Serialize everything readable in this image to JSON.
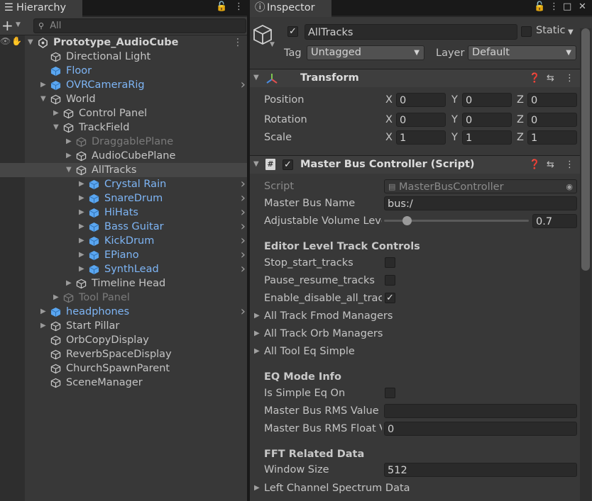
{
  "hierarchy": {
    "tab_label": "Hierarchy",
    "search_placeholder": "All",
    "add_label": "+",
    "rows": [
      {
        "label": "Prototype_AudioCube",
        "style": "bold",
        "indent": 0,
        "arrow": "down",
        "icon": "unity-icon"
      },
      {
        "label": "Directional Light",
        "style": "normal",
        "indent": 1,
        "arrow": "",
        "icon": "cube-outline-icon"
      },
      {
        "label": "Floor",
        "style": "blue",
        "indent": 1,
        "arrow": "",
        "icon": "prefab-cube-icon"
      },
      {
        "label": "OVRCameraRig",
        "style": "blue",
        "indent": 1,
        "arrow": "right",
        "icon": "prefab-cube-icon",
        "chevron": true
      },
      {
        "label": "World",
        "style": "normal",
        "indent": 1,
        "arrow": "down",
        "icon": "cube-outline-icon"
      },
      {
        "label": "Control Panel",
        "style": "normal",
        "indent": 2,
        "arrow": "right",
        "icon": "cube-outline-icon"
      },
      {
        "label": "TrackField",
        "style": "normal",
        "indent": 2,
        "arrow": "down",
        "icon": "cube-outline-icon"
      },
      {
        "label": "DraggablePlane",
        "style": "dim",
        "indent": 3,
        "arrow": "right",
        "icon": "cube-outline-icon"
      },
      {
        "label": "AudioCubePlane",
        "style": "normal",
        "indent": 3,
        "arrow": "right",
        "icon": "cube-outline-icon"
      },
      {
        "label": "AllTracks",
        "style": "normal",
        "indent": 3,
        "arrow": "down",
        "icon": "cube-outline-icon",
        "selected": true
      },
      {
        "label": "Crystal Rain",
        "style": "blue",
        "indent": 4,
        "arrow": "right",
        "icon": "prefab-cube-icon",
        "chevron": true
      },
      {
        "label": "SnareDrum",
        "style": "blue",
        "indent": 4,
        "arrow": "right",
        "icon": "prefab-cube-icon",
        "chevron": true
      },
      {
        "label": "HiHats",
        "style": "blue",
        "indent": 4,
        "arrow": "right",
        "icon": "prefab-cube-icon",
        "chevron": true
      },
      {
        "label": "Bass Guitar",
        "style": "blue",
        "indent": 4,
        "arrow": "right",
        "icon": "prefab-cube-icon",
        "chevron": true
      },
      {
        "label": "KickDrum",
        "style": "blue",
        "indent": 4,
        "arrow": "right",
        "icon": "prefab-cube-icon",
        "chevron": true
      },
      {
        "label": "EPiano",
        "style": "blue",
        "indent": 4,
        "arrow": "right",
        "icon": "prefab-cube-icon",
        "chevron": true
      },
      {
        "label": "SynthLead",
        "style": "blue",
        "indent": 4,
        "arrow": "right",
        "icon": "prefab-cube-icon",
        "chevron": true
      },
      {
        "label": "Timeline Head",
        "style": "normal",
        "indent": 3,
        "arrow": "right",
        "icon": "cube-outline-icon"
      },
      {
        "label": "Tool Panel",
        "style": "dim",
        "indent": 2,
        "arrow": "right",
        "icon": "cube-outline-icon"
      },
      {
        "label": "headphones",
        "style": "blue",
        "indent": 1,
        "arrow": "right",
        "icon": "prefab-cube-icon",
        "chevron": true
      },
      {
        "label": "Start Pillar",
        "style": "normal",
        "indent": 1,
        "arrow": "right",
        "icon": "cube-outline-icon"
      },
      {
        "label": "OrbCopyDisplay",
        "style": "normal",
        "indent": 1,
        "arrow": "",
        "icon": "cube-outline-icon"
      },
      {
        "label": "ReverbSpaceDisplay",
        "style": "normal",
        "indent": 1,
        "arrow": "",
        "icon": "cube-outline-icon"
      },
      {
        "label": "ChurchSpawnParent",
        "style": "normal",
        "indent": 1,
        "arrow": "",
        "icon": "cube-outline-icon"
      },
      {
        "label": "SceneManager",
        "style": "normal",
        "indent": 1,
        "arrow": "",
        "icon": "cube-outline-icon"
      }
    ]
  },
  "inspector": {
    "tab_label": "Inspector",
    "object_name": "AllTracks",
    "static_label": "Static",
    "tag_label": "Tag",
    "tag_value": "Untagged",
    "layer_label": "Layer",
    "layer_value": "Default",
    "transform": {
      "title": "Transform",
      "position_label": "Position",
      "rotation_label": "Rotation",
      "scale_label": "Scale",
      "axis_x": "X",
      "axis_y": "Y",
      "axis_z": "Z",
      "position": {
        "x": "0",
        "y": "0",
        "z": "0"
      },
      "rotation": {
        "x": "0",
        "y": "0",
        "z": "0"
      },
      "scale": {
        "x": "1",
        "y": "1",
        "z": "1"
      }
    },
    "script_component": {
      "title": "Master Bus Controller (Script)",
      "script_label": "Script",
      "script_value": "MasterBusController",
      "bus_name_label": "Master Bus Name",
      "bus_name_value": "bus:/",
      "volume_label": "Adjustable Volume Level",
      "volume_value": "0.7",
      "volume_fraction": 0.0,
      "editor_header": "Editor Level Track Controls",
      "stop_start_label": "Stop_start_tracks",
      "stop_start_checked": false,
      "pause_resume_label": "Pause_resume_tracks",
      "pause_resume_checked": false,
      "enable_disable_label": "Enable_disable_all_tracks",
      "enable_disable_checked": true,
      "fmod_managers_label": "All Track Fmod Managers",
      "orb_managers_label": "All Track Orb Managers",
      "tool_eq_label": "All Tool Eq Simple",
      "eq_header": "EQ Mode Info",
      "simple_eq_label": "Is Simple Eq On",
      "simple_eq_checked": false,
      "rms_value_label": "Master Bus RMS Value",
      "rms_value": "",
      "rms_float_label": "Master Bus RMS Float Value",
      "rms_float_value": "0",
      "fft_header": "FFT Related Data",
      "window_size_label": "Window Size",
      "window_size_value": "512",
      "left_channel_label": "Left Channel Spectrum Data"
    }
  }
}
